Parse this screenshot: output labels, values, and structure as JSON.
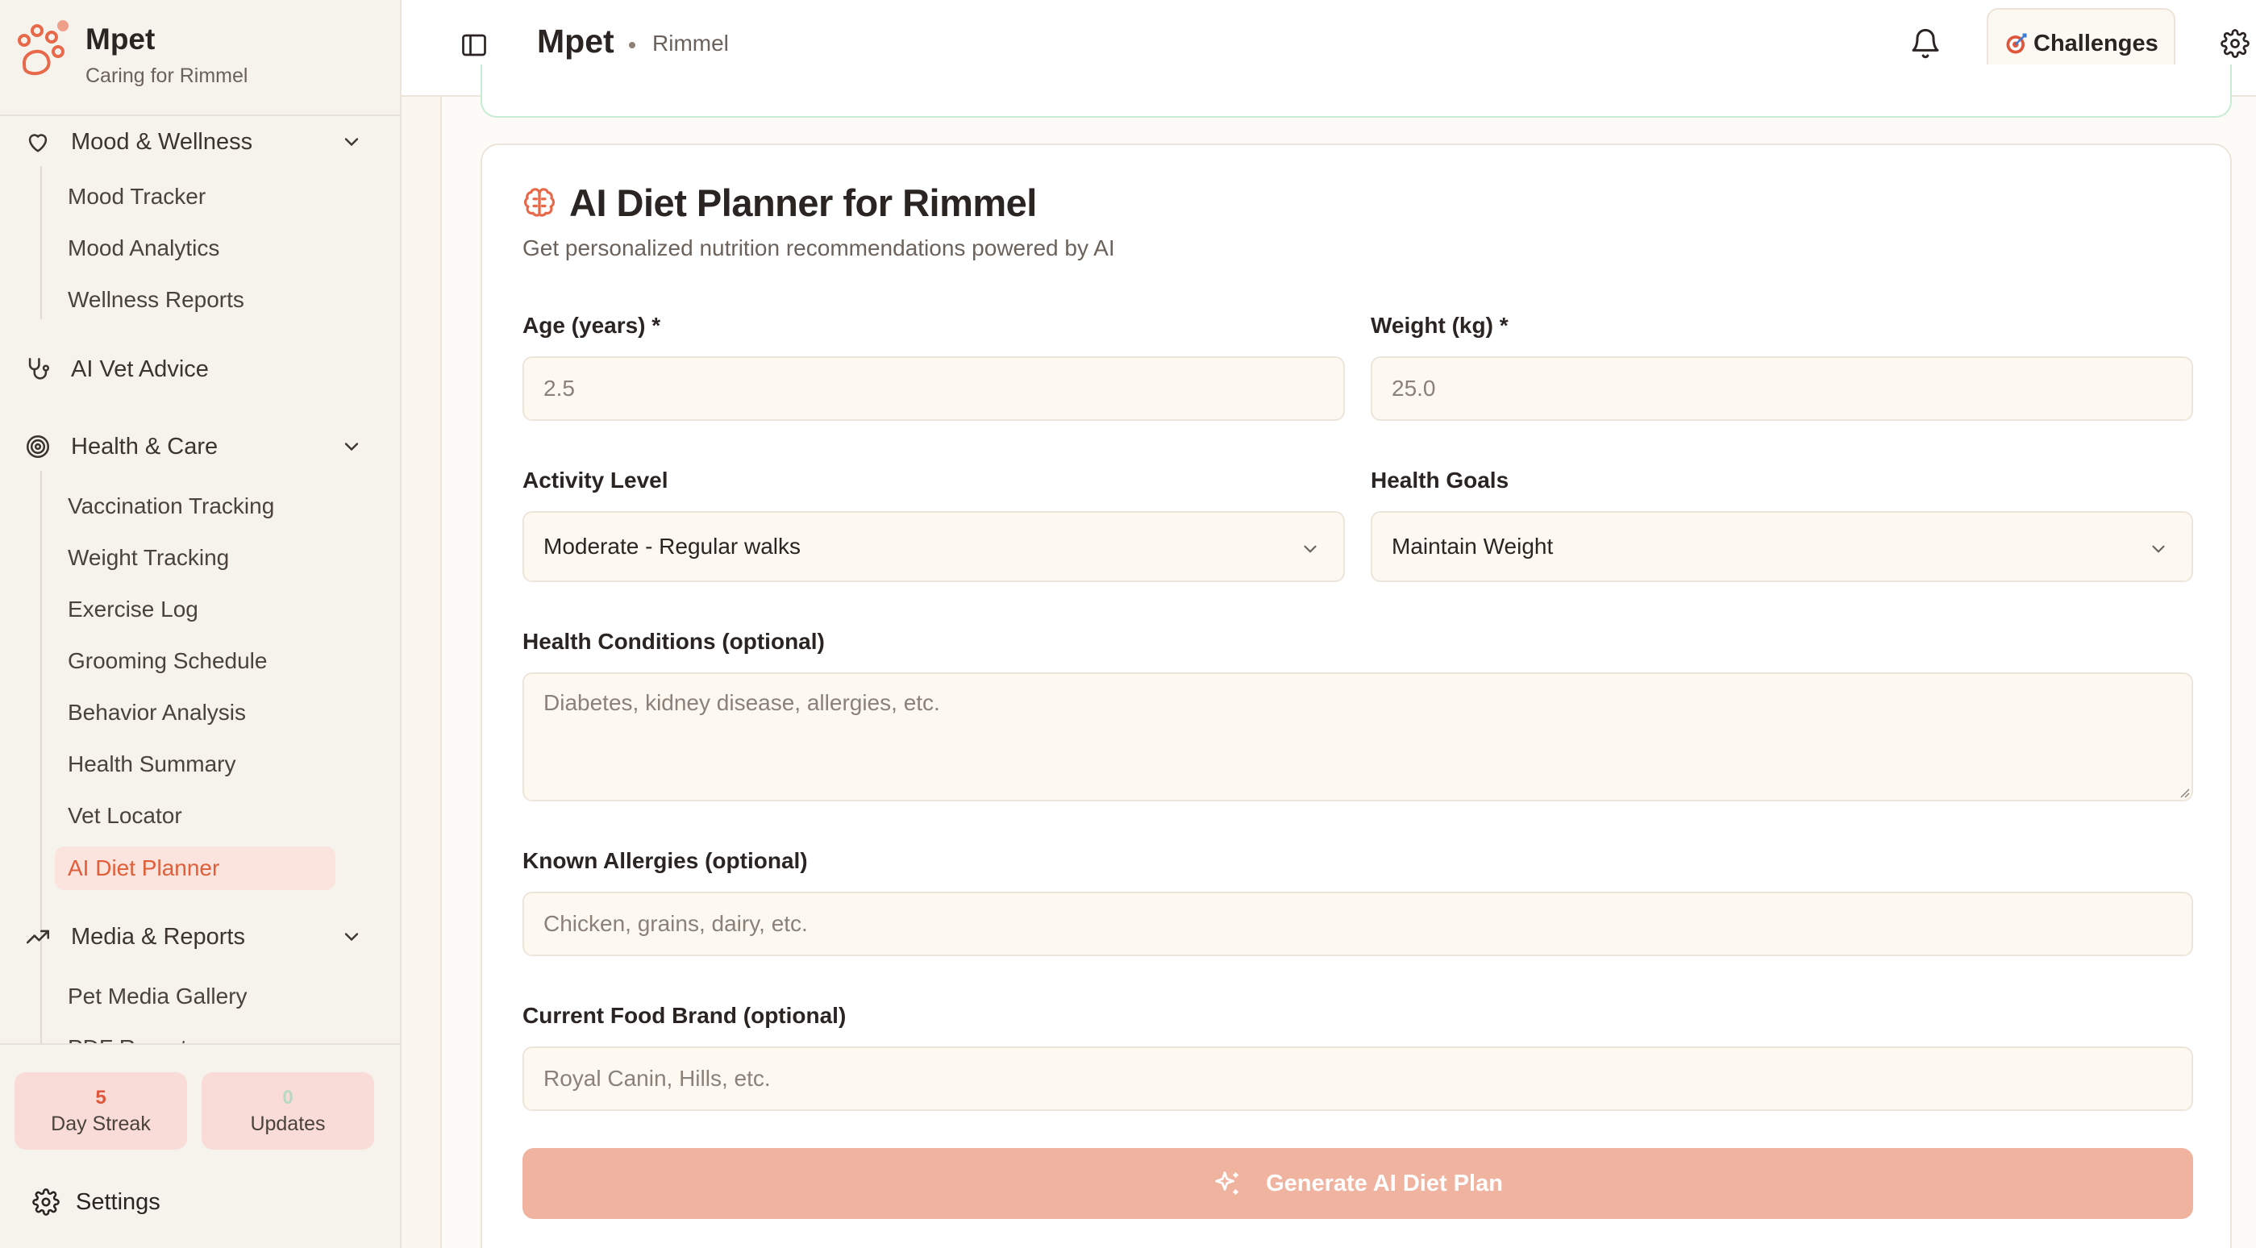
{
  "brand": {
    "name": "Mpet",
    "subtitle": "Caring for Rimmel",
    "accent": "#e8684a"
  },
  "sidebar": {
    "groups": [
      {
        "label": "Mood & Wellness",
        "icon": "heart-icon",
        "items": [
          "Mood Tracker",
          "Mood Analytics",
          "Wellness Reports"
        ]
      },
      {
        "label": "AI Vet Advice",
        "icon": "stethoscope-icon",
        "items": []
      },
      {
        "label": "Health & Care",
        "icon": "target-icon",
        "items": [
          "Vaccination Tracking",
          "Weight Tracking",
          "Exercise Log",
          "Grooming Schedule",
          "Behavior Analysis",
          "Health Summary",
          "Vet Locator",
          "AI Diet Planner"
        ]
      },
      {
        "label": "Media & Reports",
        "icon": "trending-up-icon",
        "items": [
          "Pet Media Gallery",
          "PDF Reports"
        ]
      }
    ],
    "active_item": "AI Diet Planner"
  },
  "stats": {
    "streak": {
      "value": "5",
      "label": "Day Streak",
      "color": "#e0563a"
    },
    "updates": {
      "value": "0",
      "label": "Updates",
      "color": "#b7d9c4"
    }
  },
  "settings_label": "Settings",
  "header": {
    "title": "Mpet",
    "pet_name": "Rimmel",
    "challenges_label": "Challenges"
  },
  "planner": {
    "title": "AI Diet Planner for Rimmel",
    "description": "Get personalized nutrition recommendations powered by AI",
    "age": {
      "label": "Age (years) *",
      "placeholder": "2.5"
    },
    "weight": {
      "label": "Weight (kg) *",
      "placeholder": "25.0"
    },
    "activity": {
      "label": "Activity Level",
      "value": "Moderate - Regular walks"
    },
    "goals": {
      "label": "Health Goals",
      "value": "Maintain Weight"
    },
    "conditions": {
      "label": "Health Conditions (optional)",
      "placeholder": "Diabetes, kidney disease, allergies, etc."
    },
    "allergies": {
      "label": "Known Allergies (optional)",
      "placeholder": "Chicken, grains, dairy, etc."
    },
    "food_brand": {
      "label": "Current Food Brand (optional)",
      "placeholder": "Royal Canin, Hills, etc."
    },
    "generate_label": "Generate AI Diet Plan"
  }
}
